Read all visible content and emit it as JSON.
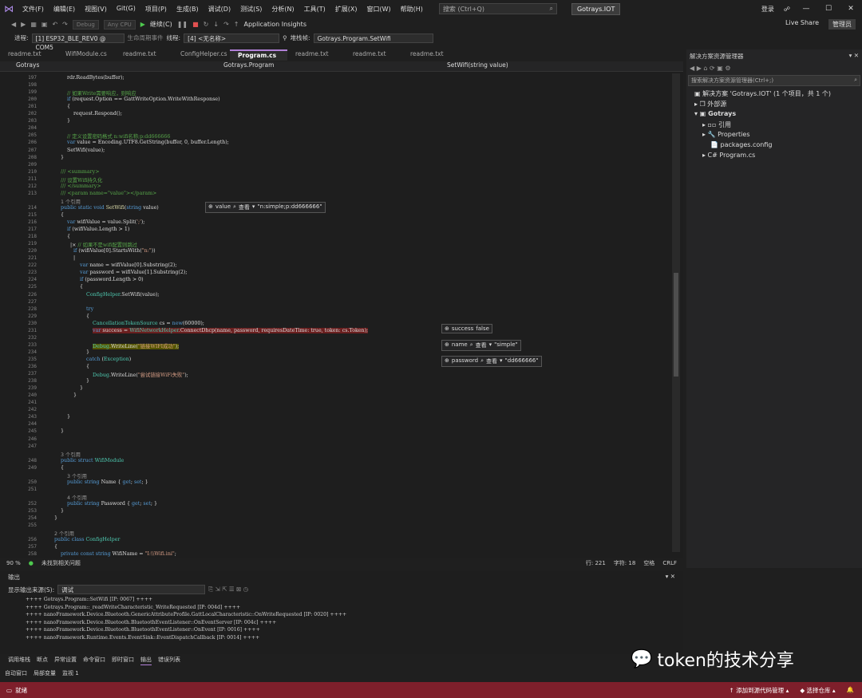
{
  "menu": [
    "文件(F)",
    "编辑(E)",
    "视图(V)",
    "Git(G)",
    "项目(P)",
    "生成(B)",
    "调试(D)",
    "测试(S)",
    "分析(N)",
    "工具(T)",
    "扩展(X)",
    "窗口(W)",
    "帮助(H)"
  ],
  "search_placeholder": "搜索 (Ctrl+Q)",
  "solution_badge": "Gotrays.IOT",
  "login": "登录",
  "admin": "管理员",
  "live_share": "Live Share",
  "toolbar1": {
    "config": "Debug",
    "platform": "Any CPU",
    "continue": "继续(C)",
    "insights": "Application Insights"
  },
  "toolbar2": {
    "process_label": "进程:",
    "process": "[1] ESP32_BLE_REV0 @ COM5",
    "lifecycle": "生命周期事件",
    "thread_label": "线程:",
    "thread": "[4] <无名称>",
    "stack_label": "堆栈帧:",
    "stack": "Gotrays.Program.SetWifi"
  },
  "tabs": [
    "readme.txt",
    "WifiModule.cs",
    "readme.txt",
    "ConfigHelper.cs",
    "Program.cs",
    "readme.txt",
    "readme.txt",
    "readme.txt"
  ],
  "nav": {
    "project": "Gotrays",
    "class": "Gotrays.Program",
    "method": "SetWifi(string value)"
  },
  "datatips": {
    "value_name": "value",
    "value_val": "\"n:simple;p:dd666666\"",
    "success_name": "success",
    "success_val": "false",
    "name_name": "name",
    "name_val": "\"simple\"",
    "pw_name": "password",
    "pw_val": "\"dd666666\"",
    "view": "查看"
  },
  "editor_status": {
    "zoom": "90 %",
    "issues": "未找到相关问题",
    "line": "行: 221",
    "char": "字符: 18",
    "space": "空格",
    "eol": "CRLF"
  },
  "solution": {
    "title": "解决方案资源管理器",
    "search": "搜索解决方案资源管理器(Ctrl+;)",
    "root": "解决方案 'Gotrays.IOT' (1 个项目，共 1 个)",
    "external": "外部源",
    "project": "Gotrays",
    "refs": "引用",
    "props": "Properties",
    "pkg": "packages.config",
    "prog": "Program.cs"
  },
  "output": {
    "title": "输出",
    "source_label": "显示输出来源(S):",
    "source": "调试",
    "lines": [
      "++++ Gotrays.Program::SetWifi [IP: 0067] ++++",
      "++++ Gotrays.Program::_readWriteCharacteristic_WriteRequested [IP: 004d] ++++",
      "++++ nanoFramework.Device.Bluetooth.GenericAttributeProfile.GattLocalCharacteristic::OnWriteRequested [IP: 0020] ++++",
      "++++ nanoFramework.Device.Bluetooth.BluetoothEventListener::OnEventServer [IP: 004c] ++++",
      "++++ nanoFramework.Device.Bluetooth.BluetoothEventListener::OnEvent [IP: 0016] ++++",
      "++++ nanoFramework.Runtime.Events.EventSink::EventDispatchCallback [IP: 0014] ++++"
    ]
  },
  "bottom_tabs": [
    "调用堆栈",
    "断点",
    "异常设置",
    "命令窗口",
    "即时窗口",
    "输出",
    "错误列表"
  ],
  "bottom_tabs2": [
    "自动窗口",
    "局部变量",
    "监视 1"
  ],
  "status": {
    "ready": "就绪",
    "add_src": "添加到源代码管理",
    "select_repo": "选择仓库"
  },
  "watermark": "token的技术分享"
}
